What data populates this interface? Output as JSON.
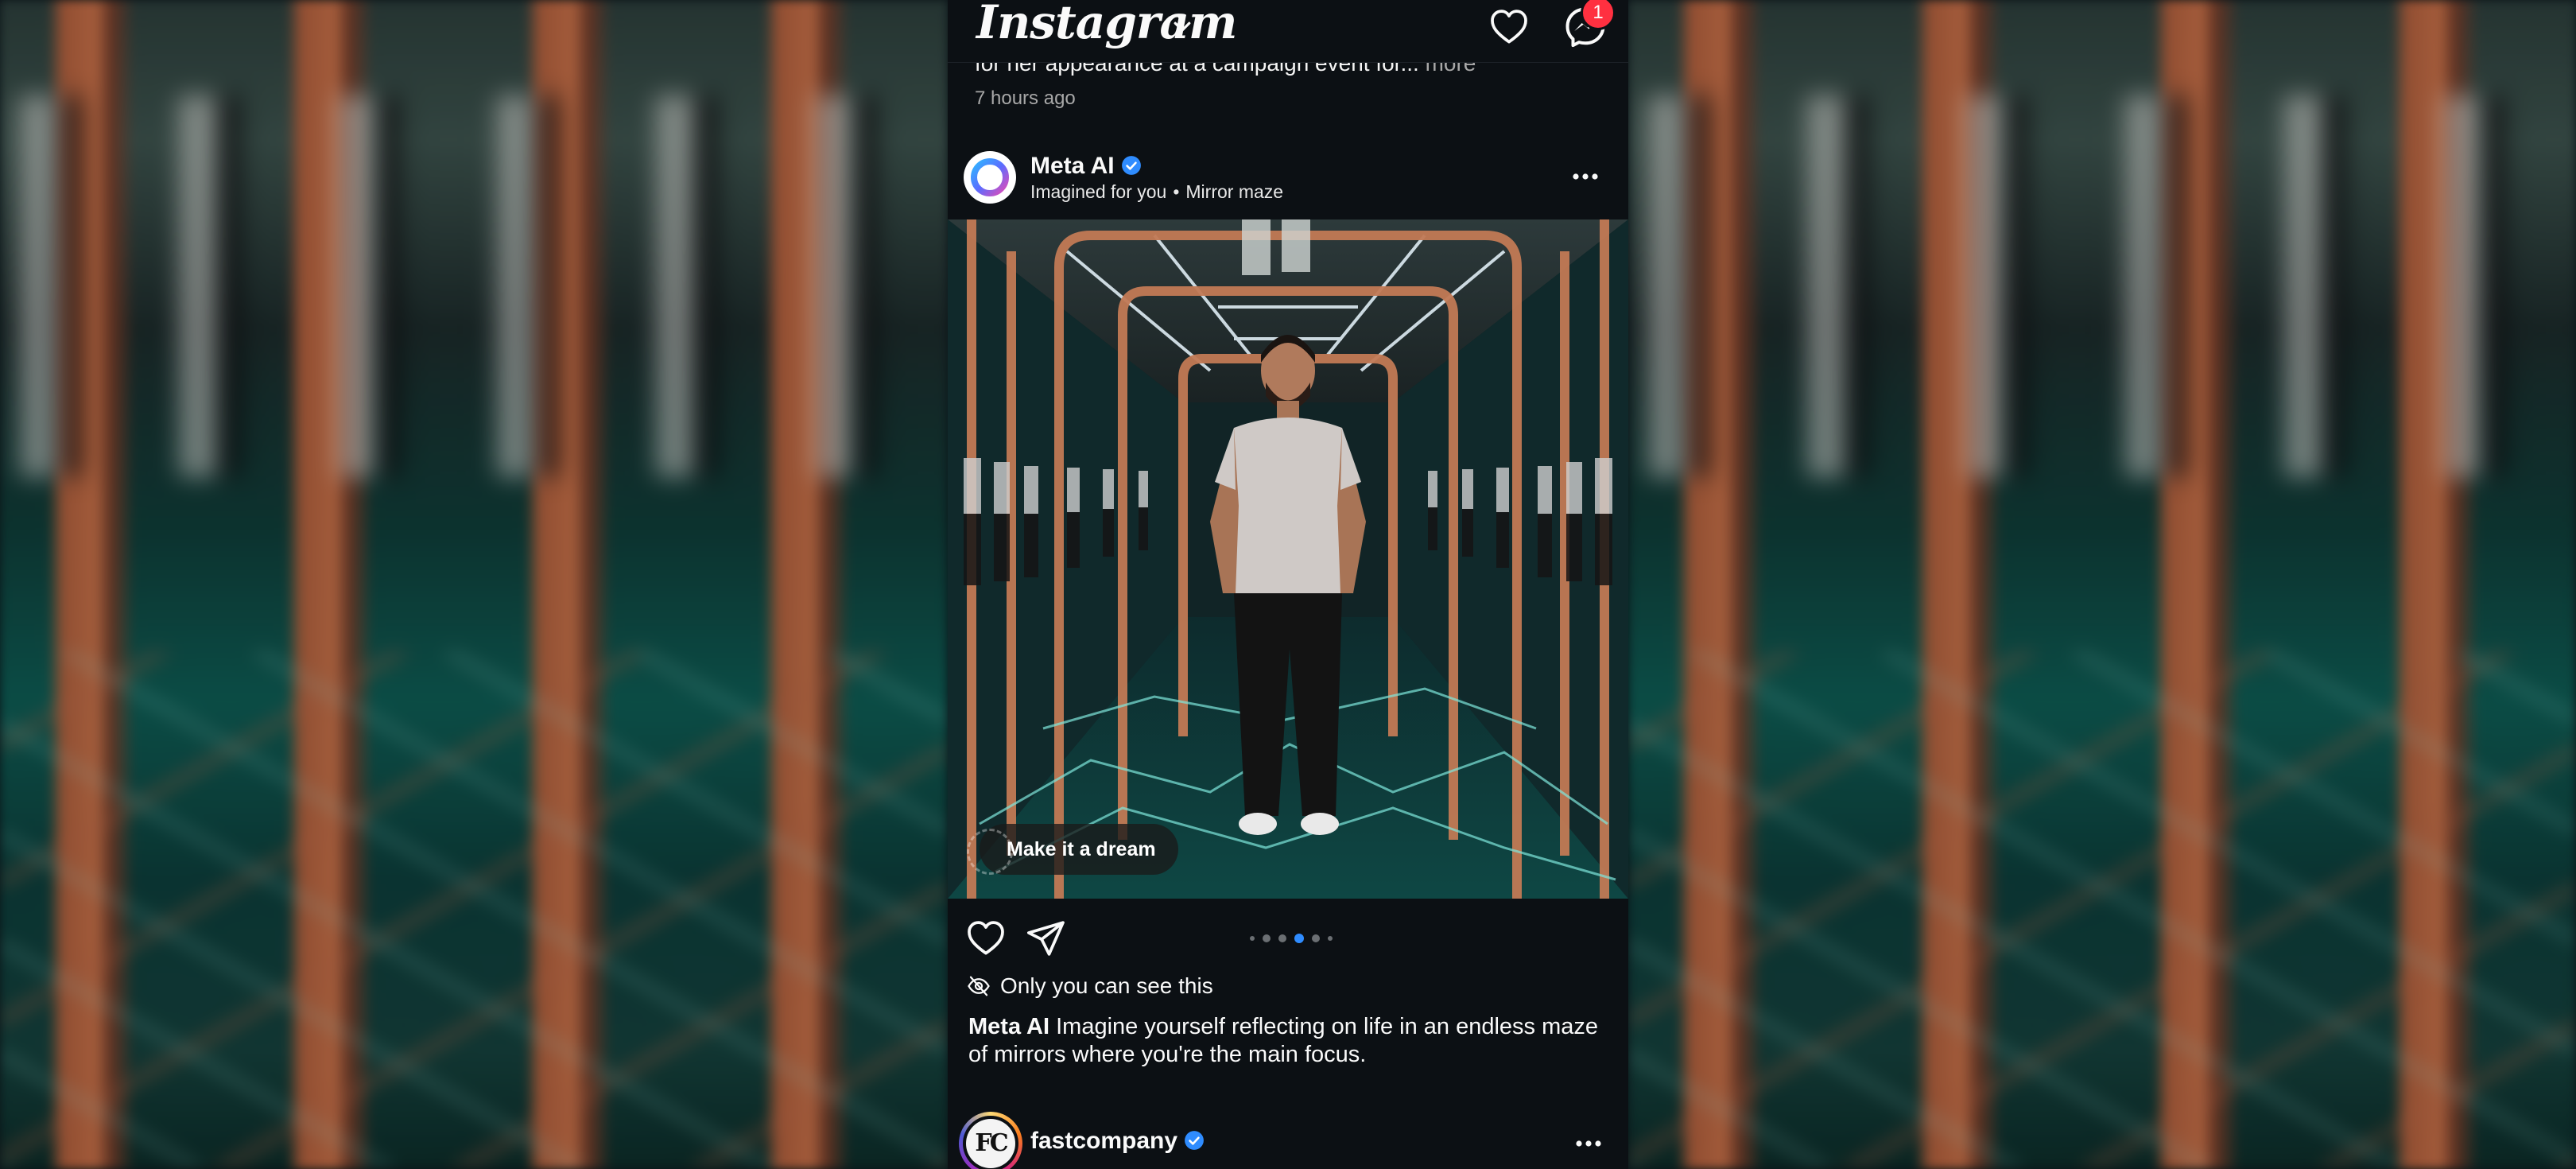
{
  "app": {
    "logo_text": "Instagram"
  },
  "header": {
    "messages_badge": "1"
  },
  "previous_post": {
    "caption_tail": "for her appearance at a campaign event for...",
    "more_label": "more",
    "time": "7 hours ago"
  },
  "post": {
    "author": "Meta AI",
    "subtitle_a": "Imagined for you",
    "subtitle_sep": "•",
    "subtitle_b": "Mirror maze",
    "make_dream_label": "Make it a dream",
    "carousel": {
      "count": 6,
      "active_index": 3
    },
    "privacy_text": "Only you can see this",
    "caption_author": "Meta AI",
    "caption_text": "Imagine yourself reflecting on life in an endless maze of mirrors where you're the main focus."
  },
  "next_post": {
    "author": "fastcompany",
    "avatar_text": "FC"
  },
  "colors": {
    "accent_blue": "#2f8cff",
    "badge_red": "#ff3040",
    "background": "#0c1014"
  }
}
